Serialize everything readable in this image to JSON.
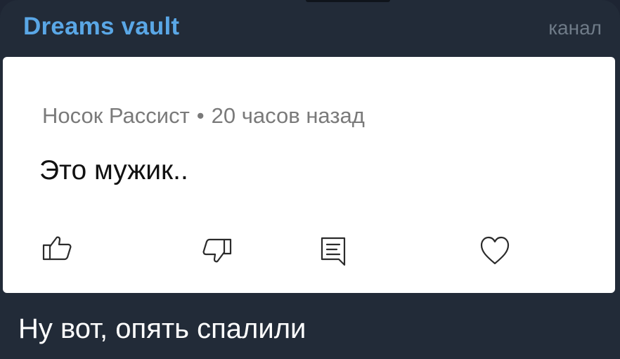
{
  "channel": {
    "name": "Dreams vault",
    "tag": "канал"
  },
  "comment_card": {
    "author": "Носок Рассист",
    "separator": "•",
    "time": "20 часов назад",
    "text": "Это мужик..",
    "actions": [
      "thumbs-up-icon",
      "thumbs-down-icon",
      "reply-comment-icon",
      "heart-icon"
    ]
  },
  "caption": "Ну вот, опять спалили",
  "colors": {
    "background": "#222b38",
    "channel_name": "#5aa7e6",
    "card": "#ffffff"
  }
}
